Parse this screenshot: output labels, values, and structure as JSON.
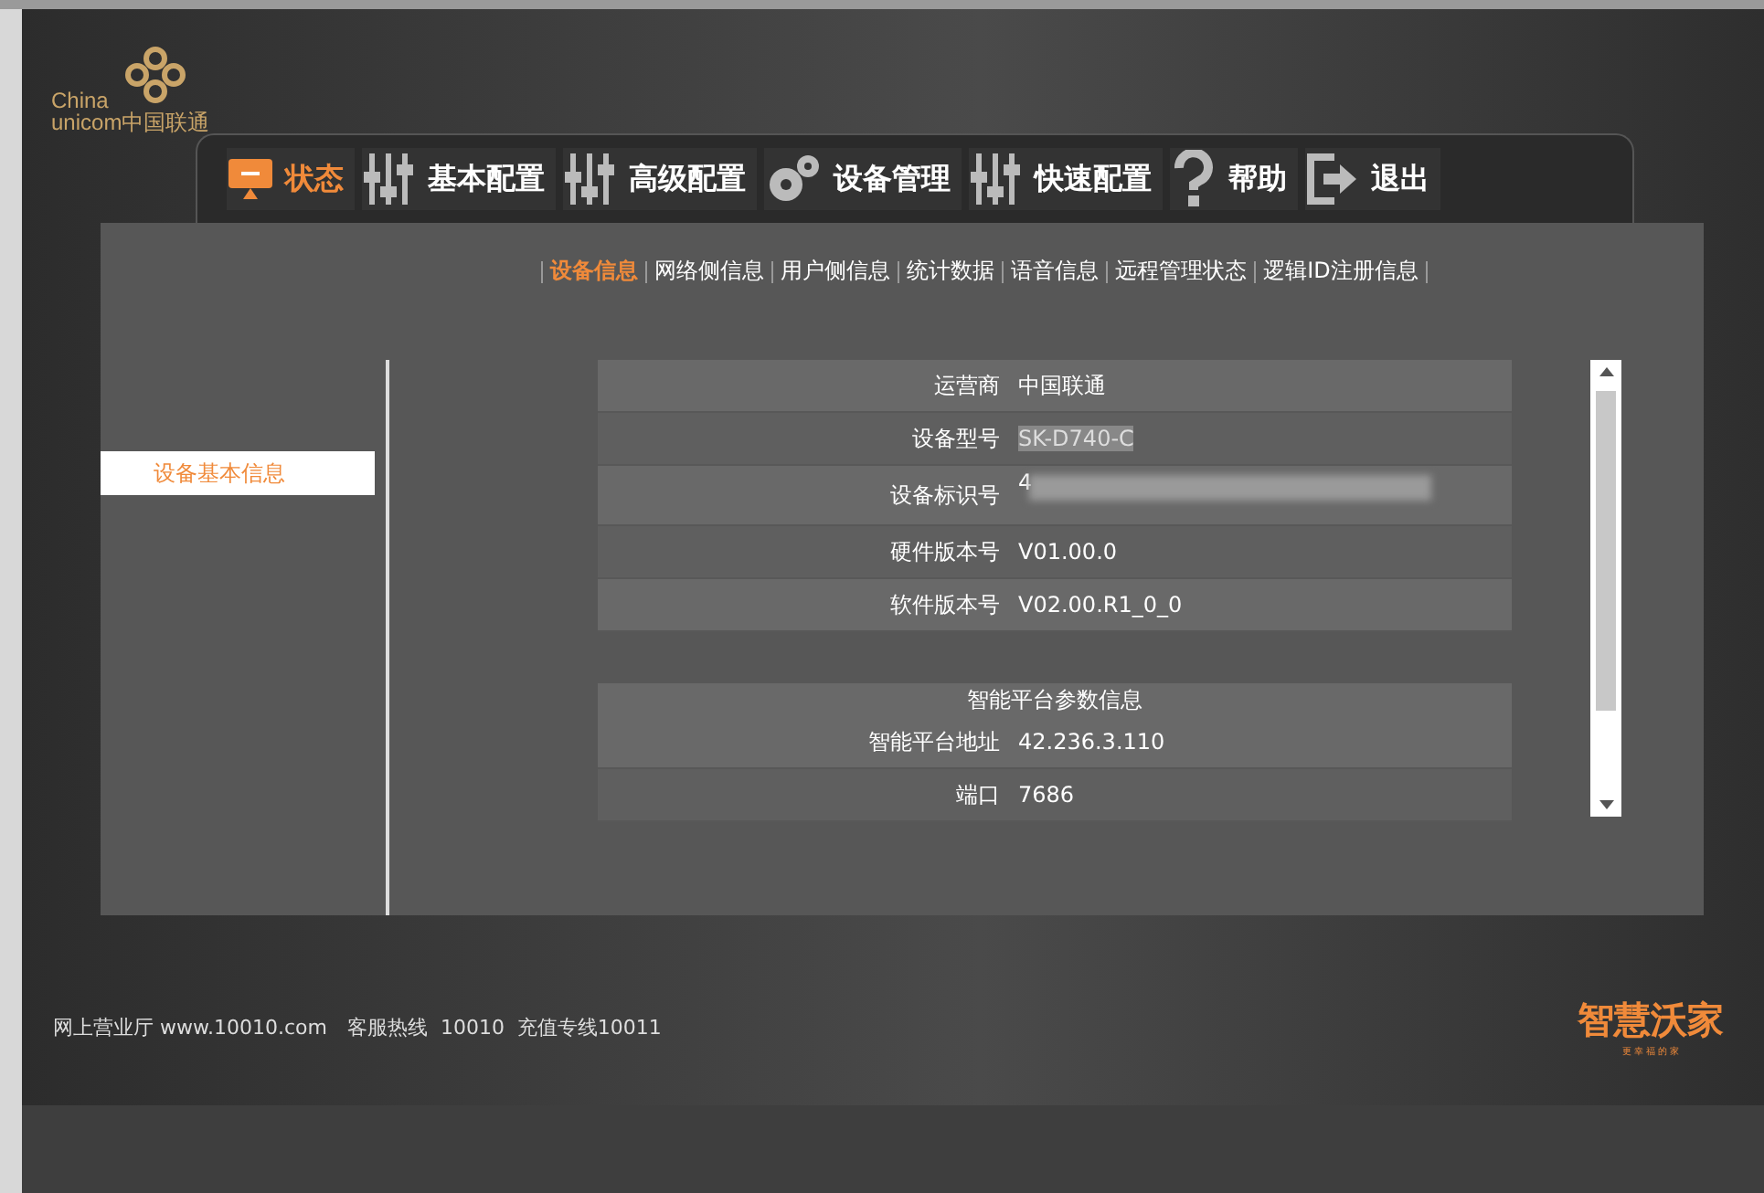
{
  "logo": {
    "line_1": "China",
    "line_2": "unicom中国联通"
  },
  "nav": [
    {
      "label": "状态",
      "kind": "monitor",
      "selected": true
    },
    {
      "label": "基本配置",
      "kind": "sliders",
      "selected": false
    },
    {
      "label": "高级配置",
      "kind": "sliders",
      "selected": false
    },
    {
      "label": "设备管理",
      "kind": "gears",
      "selected": false
    },
    {
      "label": "快速配置",
      "kind": "sliders",
      "selected": false
    },
    {
      "label": "帮助",
      "kind": "help",
      "selected": false
    },
    {
      "label": "退出",
      "kind": "exit",
      "selected": false
    }
  ],
  "subtabs": [
    {
      "label": "设备信息",
      "selected": true
    },
    {
      "label": "网络侧信息",
      "selected": false
    },
    {
      "label": "用户侧信息",
      "selected": false
    },
    {
      "label": "统计数据",
      "selected": false
    },
    {
      "label": "语音信息",
      "selected": false
    },
    {
      "label": "远程管理状态",
      "selected": false
    },
    {
      "label": "逻辑ID注册信息",
      "selected": false
    }
  ],
  "sidebar": {
    "items": [
      {
        "label": "设备基本信息",
        "selected": true
      }
    ]
  },
  "device_table": {
    "rows": [
      {
        "label": "运营商",
        "value": "中国联通"
      },
      {
        "label": "设备型号",
        "value": "SK-D740-C",
        "highlighted": true
      },
      {
        "label": "设备标识号",
        "value": "4",
        "blurred": true
      },
      {
        "label": "硬件版本号",
        "value": "V01.00.0"
      },
      {
        "label": "软件版本号",
        "value": "V02.00.R1_0_0"
      }
    ]
  },
  "platform_table": {
    "title": "智能平台参数信息",
    "rows": [
      {
        "label": "智能平台地址",
        "value": "42.236.3.110"
      },
      {
        "label": "端口",
        "value": "7686"
      }
    ]
  },
  "footer": {
    "text": "网上营业厅 www.10010.com　客服热线  10010  充值专线10011",
    "brand": "智慧沃家",
    "slogan": "更 幸 福 的 家"
  }
}
